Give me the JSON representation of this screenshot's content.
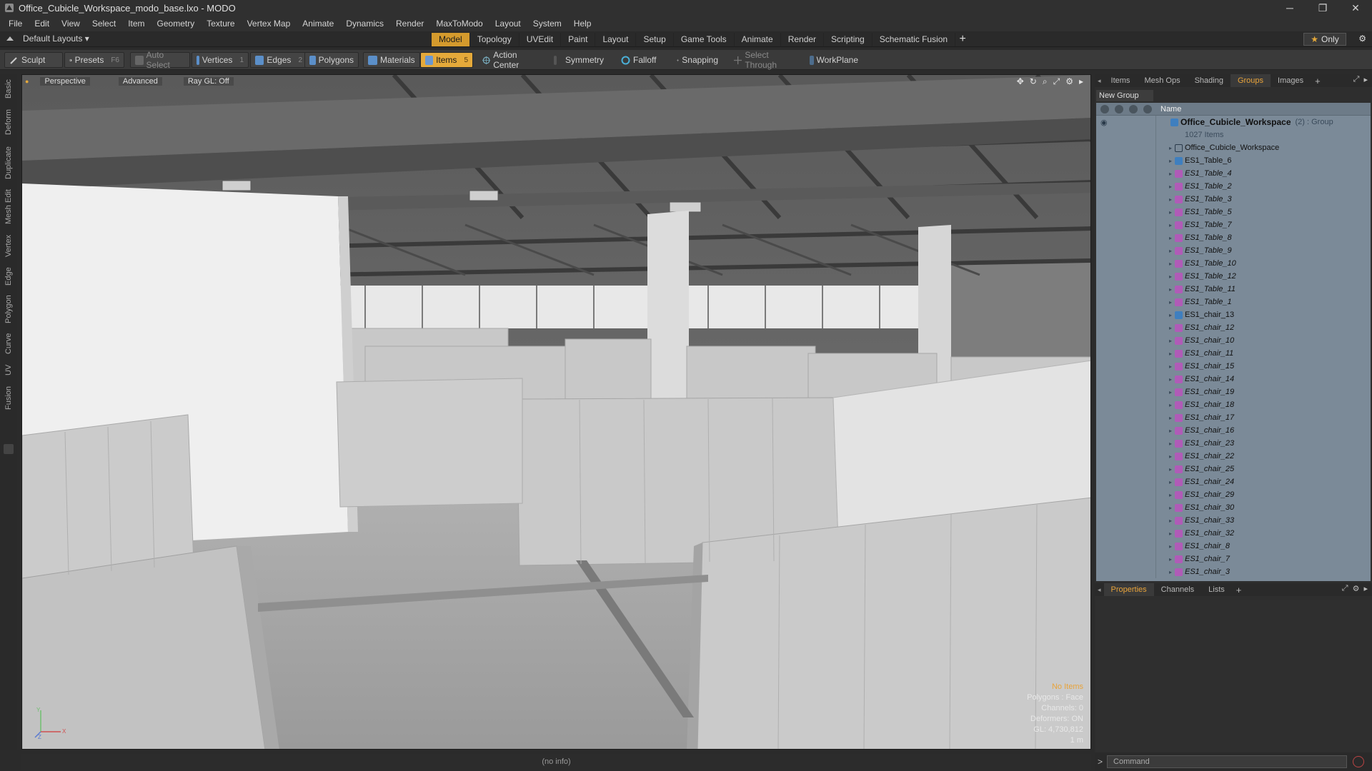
{
  "window": {
    "title": "Office_Cubicle_Workspace_modo_base.lxo - MODO",
    "minimize": "─",
    "maximize": "❐",
    "close": "✕"
  },
  "menu": [
    "File",
    "Edit",
    "View",
    "Select",
    "Item",
    "Geometry",
    "Texture",
    "Vertex Map",
    "Animate",
    "Dynamics",
    "Render",
    "MaxToModo",
    "Layout",
    "System",
    "Help"
  ],
  "layout_bar": {
    "layouts_label": "Default Layouts ▾",
    "tabs": [
      "Model",
      "Topology",
      "UVEdit",
      "Paint",
      "Layout",
      "Setup",
      "Game Tools",
      "Animate",
      "Render",
      "Scripting",
      "Schematic Fusion"
    ],
    "active_tab": "Model",
    "plus": "+",
    "only_label": "Only"
  },
  "toolbar": {
    "sculpt": "Sculpt",
    "presets": "Presets",
    "presets_key": "F6",
    "auto_select": "Auto Select",
    "vertices": "Vertices",
    "vertices_key": "1",
    "edges": "Edges",
    "edges_key": "2",
    "polygons": "Polygons",
    "materials": "Materials",
    "items": "Items",
    "items_key": "5",
    "action_center": "Action Center",
    "symmetry": "Symmetry",
    "falloff": "Falloff",
    "snapping": "Snapping",
    "select_through": "Select Through",
    "workplane": "WorkPlane"
  },
  "left_tabs": [
    "Basic",
    "Deform",
    "Duplicate",
    "Mesh Edit",
    "Vertex",
    "Edge",
    "Polygon",
    "Curve",
    "UV",
    "Fusion"
  ],
  "viewport": {
    "view": "Perspective",
    "shading": "Advanced",
    "raygl": "Ray GL: Off",
    "info": {
      "no_items": "No Items",
      "polygons": "Polygons : Face",
      "channels": "Channels: 0",
      "deformers": "Deformers: ON",
      "gl": "GL: 4,730,812",
      "scale": "1 m"
    },
    "axis_y": "Y",
    "axis_x": "X",
    "axis_z": "Z"
  },
  "status": {
    "text": "(no info)"
  },
  "right_panel": {
    "top_tabs": [
      "Items",
      "Mesh Ops",
      "Shading",
      "Groups",
      "Images"
    ],
    "active_top_tab": "Groups",
    "new_group": "New Group",
    "name_header": "Name",
    "group": {
      "name": "Office_Cubicle_Workspace",
      "suffix": "(2) : Group",
      "count": "1027 Items"
    },
    "items": [
      {
        "label": "Office_Cubicle_Workspace",
        "type": "loc",
        "italic": false
      },
      {
        "label": "ES1_Table_6",
        "type": "mesh",
        "italic": false
      },
      {
        "label": "ES1_Table_4",
        "type": "inst",
        "italic": true
      },
      {
        "label": "ES1_Table_2",
        "type": "inst",
        "italic": true
      },
      {
        "label": "ES1_Table_3",
        "type": "inst",
        "italic": true
      },
      {
        "label": "ES1_Table_5",
        "type": "inst",
        "italic": true
      },
      {
        "label": "ES1_Table_7",
        "type": "inst",
        "italic": true
      },
      {
        "label": "ES1_Table_8",
        "type": "inst",
        "italic": true
      },
      {
        "label": "ES1_Table_9",
        "type": "inst",
        "italic": true
      },
      {
        "label": "ES1_Table_10",
        "type": "inst",
        "italic": true
      },
      {
        "label": "ES1_Table_12",
        "type": "inst",
        "italic": true
      },
      {
        "label": "ES1_Table_11",
        "type": "inst",
        "italic": true
      },
      {
        "label": "ES1_Table_1",
        "type": "inst",
        "italic": true
      },
      {
        "label": "ES1_chair_13",
        "type": "mesh",
        "italic": false
      },
      {
        "label": "ES1_chair_12",
        "type": "inst",
        "italic": true
      },
      {
        "label": "ES1_chair_10",
        "type": "inst",
        "italic": true
      },
      {
        "label": "ES1_chair_11",
        "type": "inst",
        "italic": true
      },
      {
        "label": "ES1_chair_15",
        "type": "inst",
        "italic": true
      },
      {
        "label": "ES1_chair_14",
        "type": "inst",
        "italic": true
      },
      {
        "label": "ES1_chair_19",
        "type": "inst",
        "italic": true
      },
      {
        "label": "ES1_chair_18",
        "type": "inst",
        "italic": true
      },
      {
        "label": "ES1_chair_17",
        "type": "inst",
        "italic": true
      },
      {
        "label": "ES1_chair_16",
        "type": "inst",
        "italic": true
      },
      {
        "label": "ES1_chair_23",
        "type": "inst",
        "italic": true
      },
      {
        "label": "ES1_chair_22",
        "type": "inst",
        "italic": true
      },
      {
        "label": "ES1_chair_25",
        "type": "inst",
        "italic": true
      },
      {
        "label": "ES1_chair_24",
        "type": "inst",
        "italic": true
      },
      {
        "label": "ES1_chair_29",
        "type": "inst",
        "italic": true
      },
      {
        "label": "ES1_chair_30",
        "type": "inst",
        "italic": true
      },
      {
        "label": "ES1_chair_33",
        "type": "inst",
        "italic": true
      },
      {
        "label": "ES1_chair_32",
        "type": "inst",
        "italic": true
      },
      {
        "label": "ES1_chair_8",
        "type": "inst",
        "italic": true
      },
      {
        "label": "ES1_chair_7",
        "type": "inst",
        "italic": true
      },
      {
        "label": "ES1_chair_3",
        "type": "inst",
        "italic": true
      }
    ],
    "bottom_tabs": [
      "Properties",
      "Channels",
      "Lists"
    ],
    "active_bottom_tab": "Properties",
    "command_placeholder": "Command"
  },
  "colors": {
    "accent": "#e5a93a",
    "groups_bg": "#7b8a98",
    "instance_icon": "#b05bb7",
    "mesh_icon": "#3f7fbf"
  },
  "icons": {
    "presets": "presets-icon",
    "sculpt": "sculpt-icon",
    "gear": "gear-icon",
    "star": "star-icon"
  }
}
